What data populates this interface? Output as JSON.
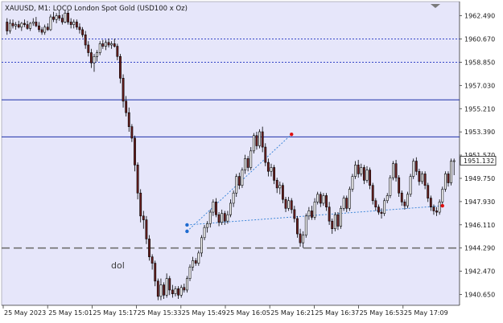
{
  "window": {
    "title": "XAUUSD, M1:  LOCO London Spot Gold (USD100 x Oz)"
  },
  "annotation": {
    "label": "dol"
  },
  "price_labels": [
    "1962.490",
    "1960.670",
    "1958.850",
    "1957.030",
    "1955.210",
    "1953.390",
    "1951.570",
    "1949.750",
    "1947.930",
    "1946.110",
    "1944.290",
    "1942.470",
    "1940.650"
  ],
  "time_labels": [
    "25 May 2023",
    "25 May 15:01",
    "25 May 15:17",
    "25 May 15:33",
    "25 May 15:49",
    "25 May 16:05",
    "25 May 16:21",
    "25 May 16:37",
    "25 May 16:53",
    "25 May 17:09"
  ],
  "current_price": {
    "label": "1951.132",
    "value": 1951.132
  },
  "colors": {
    "background": "#ffffff",
    "chart_area": "#e6e6fa",
    "bull_candle": "#ffffff",
    "bear_candle": "#6b1f1f",
    "wick": "#000000",
    "hline_solid": "#1c2fa8",
    "hline_dotted": "#3546c8",
    "hline_dashed": "#707070",
    "trendline": "#2f7fd6",
    "marker_red": "#e01010",
    "marker_blue": "#1e6bd0"
  },
  "chart_data": {
    "type": "candlestick",
    "symbol": "XAUUSD",
    "timeframe": "M1",
    "x": [
      "25 May 2023",
      "25 May 15:01",
      "25 May 15:17",
      "25 May 15:33",
      "25 May 15:49",
      "25 May 16:05",
      "25 May 16:21",
      "25 May 16:37",
      "25 May 16:53",
      "25 May 17:09"
    ],
    "ylim": [
      1939.8,
      1963.6
    ],
    "y_ticks": [
      1962.49,
      1960.67,
      1958.85,
      1957.03,
      1955.21,
      1953.39,
      1951.57,
      1949.75,
      1947.93,
      1946.11,
      1944.29,
      1942.47,
      1940.65
    ],
    "current_price": 1951.132,
    "horizontal_lines": [
      {
        "price": 1960.67,
        "style": "dotted"
      },
      {
        "price": 1958.85,
        "style": "dotted"
      },
      {
        "price": 1955.9,
        "style": "solid"
      },
      {
        "price": 1953.0,
        "style": "solid"
      },
      {
        "price": 1944.29,
        "style": "dashed"
      }
    ],
    "trendlines": [
      {
        "from": [
          62,
          1945.6
        ],
        "to": [
          98,
          1953.2
        ]
      },
      {
        "from": [
          62,
          1946.1
        ],
        "to": [
          150,
          1947.6
        ]
      }
    ],
    "markers": [
      {
        "index": 98,
        "price": 1953.2,
        "color": "red"
      },
      {
        "index": 150,
        "price": 1947.6,
        "color": "red"
      },
      {
        "index": 62,
        "price": 1945.6,
        "color": "blue"
      },
      {
        "index": 62,
        "price": 1946.1,
        "color": "blue"
      }
    ],
    "candles": [
      [
        1962.0,
        1962.3,
        1961.0,
        1961.3
      ],
      [
        1961.3,
        1962.2,
        1961.1,
        1961.9
      ],
      [
        1961.9,
        1962.2,
        1961.5,
        1961.7
      ],
      [
        1961.7,
        1962.0,
        1961.4,
        1961.8
      ],
      [
        1961.8,
        1962.1,
        1961.5,
        1961.6
      ],
      [
        1961.6,
        1962.0,
        1961.3,
        1961.9
      ],
      [
        1961.9,
        1962.2,
        1961.6,
        1961.8
      ],
      [
        1961.8,
        1962.1,
        1961.4,
        1961.5
      ],
      [
        1961.5,
        1962.0,
        1961.3,
        1961.9
      ],
      [
        1961.9,
        1962.3,
        1961.7,
        1962.0
      ],
      [
        1962.0,
        1962.4,
        1961.6,
        1961.7
      ],
      [
        1961.7,
        1962.0,
        1961.2,
        1961.4
      ],
      [
        1961.4,
        1961.6,
        1961.0,
        1961.2
      ],
      [
        1961.2,
        1961.8,
        1961.0,
        1961.6
      ],
      [
        1961.6,
        1961.9,
        1961.3,
        1961.4
      ],
      [
        1961.4,
        1962.6,
        1961.3,
        1962.4
      ],
      [
        1962.4,
        1962.8,
        1962.0,
        1962.2
      ],
      [
        1962.2,
        1962.7,
        1961.9,
        1962.5
      ],
      [
        1962.5,
        1962.9,
        1962.1,
        1962.3
      ],
      [
        1962.3,
        1962.6,
        1961.8,
        1962.0
      ],
      [
        1962.0,
        1962.9,
        1961.9,
        1962.7
      ],
      [
        1962.7,
        1962.9,
        1961.8,
        1962.0
      ],
      [
        1962.0,
        1962.3,
        1961.5,
        1961.8
      ],
      [
        1961.8,
        1962.2,
        1961.5,
        1962.0
      ],
      [
        1962.0,
        1962.2,
        1961.4,
        1961.6
      ],
      [
        1961.6,
        1961.9,
        1961.1,
        1961.4
      ],
      [
        1961.4,
        1961.6,
        1960.8,
        1961.0
      ],
      [
        1961.0,
        1961.3,
        1959.9,
        1960.2
      ],
      [
        1960.2,
        1960.5,
        1959.3,
        1959.6
      ],
      [
        1959.6,
        1959.9,
        1958.4,
        1958.8
      ],
      [
        1958.8,
        1959.5,
        1958.1,
        1959.3
      ],
      [
        1959.3,
        1959.8,
        1958.9,
        1959.6
      ],
      [
        1959.6,
        1960.5,
        1959.4,
        1960.3
      ],
      [
        1960.3,
        1960.6,
        1959.9,
        1960.1
      ],
      [
        1960.1,
        1960.6,
        1959.8,
        1960.4
      ],
      [
        1960.4,
        1960.7,
        1960.0,
        1960.2
      ],
      [
        1960.2,
        1960.5,
        1959.9,
        1960.3
      ],
      [
        1960.3,
        1960.7,
        1960.0,
        1960.1
      ],
      [
        1960.1,
        1960.3,
        1959.0,
        1959.3
      ],
      [
        1959.3,
        1959.5,
        1957.2,
        1957.6
      ],
      [
        1957.6,
        1957.9,
        1955.3,
        1955.8
      ],
      [
        1955.8,
        1956.2,
        1954.6,
        1954.9
      ],
      [
        1954.9,
        1955.3,
        1953.4,
        1953.8
      ],
      [
        1953.8,
        1954.0,
        1952.6,
        1952.9
      ],
      [
        1952.9,
        1953.1,
        1950.3,
        1950.8
      ],
      [
        1950.8,
        1951.0,
        1948.1,
        1948.6
      ],
      [
        1948.6,
        1948.9,
        1946.3,
        1946.8
      ],
      [
        1946.8,
        1947.2,
        1945.8,
        1946.5
      ],
      [
        1946.5,
        1946.8,
        1944.6,
        1945.0
      ],
      [
        1945.0,
        1945.3,
        1943.3,
        1943.6
      ],
      [
        1943.6,
        1943.8,
        1942.6,
        1943.1
      ],
      [
        1943.1,
        1943.3,
        1941.3,
        1941.7
      ],
      [
        1941.7,
        1941.9,
        1940.2,
        1940.5
      ],
      [
        1940.5,
        1941.9,
        1940.2,
        1941.4
      ],
      [
        1941.4,
        1941.6,
        1940.3,
        1940.6
      ],
      [
        1940.6,
        1942.3,
        1940.4,
        1941.9
      ],
      [
        1941.9,
        1942.1,
        1940.6,
        1941.0
      ],
      [
        1941.0,
        1941.4,
        1940.4,
        1940.7
      ],
      [
        1940.7,
        1941.3,
        1940.5,
        1941.1
      ],
      [
        1941.1,
        1941.3,
        1940.3,
        1940.6
      ],
      [
        1940.6,
        1941.4,
        1940.4,
        1941.2
      ],
      [
        1941.2,
        1941.5,
        1940.8,
        1941.0
      ],
      [
        1941.0,
        1942.1,
        1940.8,
        1941.9
      ],
      [
        1941.9,
        1943.0,
        1941.7,
        1942.8
      ],
      [
        1942.8,
        1943.6,
        1942.5,
        1943.3
      ],
      [
        1943.3,
        1943.5,
        1942.9,
        1943.1
      ],
      [
        1943.1,
        1944.1,
        1942.9,
        1943.9
      ],
      [
        1943.9,
        1945.3,
        1943.6,
        1945.1
      ],
      [
        1945.1,
        1946.1,
        1944.9,
        1945.9
      ],
      [
        1945.9,
        1946.4,
        1945.5,
        1946.2
      ],
      [
        1946.2,
        1947.3,
        1945.9,
        1947.1
      ],
      [
        1947.1,
        1948.1,
        1946.8,
        1947.9
      ],
      [
        1947.9,
        1948.2,
        1946.7,
        1946.9
      ],
      [
        1946.9,
        1947.1,
        1946.0,
        1946.3
      ],
      [
        1946.3,
        1947.3,
        1946.1,
        1947.0
      ],
      [
        1947.0,
        1947.2,
        1946.1,
        1946.4
      ],
      [
        1946.4,
        1947.2,
        1946.2,
        1946.9
      ],
      [
        1946.9,
        1948.1,
        1946.7,
        1947.8
      ],
      [
        1947.8,
        1948.8,
        1947.5,
        1948.6
      ],
      [
        1948.6,
        1950.1,
        1948.3,
        1949.9
      ],
      [
        1949.9,
        1950.2,
        1948.9,
        1949.2
      ],
      [
        1949.2,
        1950.6,
        1949.0,
        1950.4
      ],
      [
        1950.4,
        1951.6,
        1950.1,
        1951.3
      ],
      [
        1951.3,
        1951.5,
        1950.3,
        1950.6
      ],
      [
        1950.6,
        1952.2,
        1950.4,
        1951.9
      ],
      [
        1951.9,
        1953.3,
        1951.7,
        1953.1
      ],
      [
        1953.1,
        1953.4,
        1952.0,
        1952.3
      ],
      [
        1952.3,
        1953.6,
        1952.1,
        1953.4
      ],
      [
        1953.4,
        1953.8,
        1951.8,
        1952.2
      ],
      [
        1952.2,
        1952.5,
        1950.7,
        1951.0
      ],
      [
        1951.0,
        1951.3,
        1949.9,
        1950.3
      ],
      [
        1950.3,
        1950.9,
        1949.9,
        1950.6
      ],
      [
        1950.6,
        1950.8,
        1949.3,
        1949.6
      ],
      [
        1949.6,
        1949.8,
        1948.6,
        1949.0
      ],
      [
        1949.0,
        1949.5,
        1948.5,
        1949.2
      ],
      [
        1949.2,
        1949.4,
        1947.8,
        1948.1
      ],
      [
        1948.1,
        1948.3,
        1947.1,
        1947.4
      ],
      [
        1947.4,
        1948.3,
        1947.2,
        1948.0
      ],
      [
        1948.0,
        1948.2,
        1947.0,
        1947.3
      ],
      [
        1947.3,
        1947.6,
        1946.3,
        1946.6
      ],
      [
        1946.6,
        1946.8,
        1945.1,
        1945.4
      ],
      [
        1945.4,
        1945.8,
        1944.4,
        1944.7
      ],
      [
        1944.7,
        1945.6,
        1944.3,
        1945.3
      ],
      [
        1945.3,
        1947.0,
        1945.1,
        1946.8
      ],
      [
        1946.8,
        1947.5,
        1946.5,
        1947.2
      ],
      [
        1947.2,
        1947.6,
        1946.5,
        1946.7
      ],
      [
        1946.7,
        1948.2,
        1946.5,
        1947.9
      ],
      [
        1947.9,
        1948.7,
        1947.7,
        1948.5
      ],
      [
        1948.5,
        1948.7,
        1947.5,
        1947.8
      ],
      [
        1947.8,
        1948.6,
        1947.6,
        1948.4
      ],
      [
        1948.4,
        1948.6,
        1947.2,
        1947.5
      ],
      [
        1947.5,
        1947.9,
        1946.1,
        1946.4
      ],
      [
        1946.4,
        1946.6,
        1945.4,
        1945.8
      ],
      [
        1945.8,
        1947.1,
        1945.6,
        1946.9
      ],
      [
        1946.9,
        1947.1,
        1945.7,
        1946.0
      ],
      [
        1946.0,
        1947.6,
        1945.8,
        1947.4
      ],
      [
        1947.4,
        1948.4,
        1947.2,
        1948.2
      ],
      [
        1948.2,
        1948.4,
        1947.1,
        1947.4
      ],
      [
        1947.4,
        1949.1,
        1947.2,
        1948.9
      ],
      [
        1948.9,
        1950.1,
        1948.7,
        1949.9
      ],
      [
        1949.9,
        1951.1,
        1949.7,
        1950.8
      ],
      [
        1950.8,
        1951.2,
        1949.8,
        1950.1
      ],
      [
        1950.1,
        1950.9,
        1949.9,
        1950.6
      ],
      [
        1950.6,
        1950.8,
        1949.3,
        1949.6
      ],
      [
        1949.6,
        1950.7,
        1949.4,
        1950.4
      ],
      [
        1950.4,
        1950.6,
        1948.9,
        1949.2
      ],
      [
        1949.2,
        1949.4,
        1947.7,
        1948.0
      ],
      [
        1948.0,
        1948.2,
        1947.2,
        1947.5
      ],
      [
        1947.5,
        1947.7,
        1946.9,
        1947.1
      ],
      [
        1947.1,
        1947.4,
        1946.6,
        1947.0
      ],
      [
        1947.0,
        1948.2,
        1946.8,
        1948.0
      ],
      [
        1948.0,
        1948.6,
        1947.8,
        1948.4
      ],
      [
        1948.4,
        1950.0,
        1948.2,
        1949.8
      ],
      [
        1949.8,
        1951.1,
        1949.6,
        1950.9
      ],
      [
        1950.9,
        1951.2,
        1949.5,
        1949.8
      ],
      [
        1949.8,
        1950.0,
        1948.3,
        1948.6
      ],
      [
        1948.6,
        1948.8,
        1947.6,
        1947.9
      ],
      [
        1947.9,
        1948.1,
        1947.3,
        1947.6
      ],
      [
        1947.6,
        1948.7,
        1947.4,
        1948.5
      ],
      [
        1948.5,
        1950.1,
        1948.3,
        1949.9
      ],
      [
        1949.9,
        1951.3,
        1949.7,
        1951.1
      ],
      [
        1951.1,
        1951.4,
        1950.0,
        1950.3
      ],
      [
        1950.3,
        1950.5,
        1949.2,
        1949.5
      ],
      [
        1949.5,
        1950.3,
        1949.3,
        1950.1
      ],
      [
        1950.1,
        1950.3,
        1948.9,
        1949.2
      ],
      [
        1949.2,
        1949.4,
        1947.9,
        1948.2
      ],
      [
        1948.2,
        1948.4,
        1947.2,
        1947.5
      ],
      [
        1947.5,
        1947.7,
        1946.9,
        1947.2
      ],
      [
        1947.2,
        1947.5,
        1946.8,
        1947.1
      ],
      [
        1947.1,
        1948.1,
        1946.9,
        1947.9
      ],
      [
        1947.9,
        1949.1,
        1947.7,
        1948.9
      ],
      [
        1948.9,
        1950.3,
        1948.7,
        1950.1
      ],
      [
        1950.1,
        1950.3,
        1949.1,
        1949.4
      ],
      [
        1949.4,
        1951.3,
        1949.2,
        1951.1
      ],
      [
        1951.1,
        1951.3,
        1950.0,
        1951.13
      ]
    ]
  }
}
